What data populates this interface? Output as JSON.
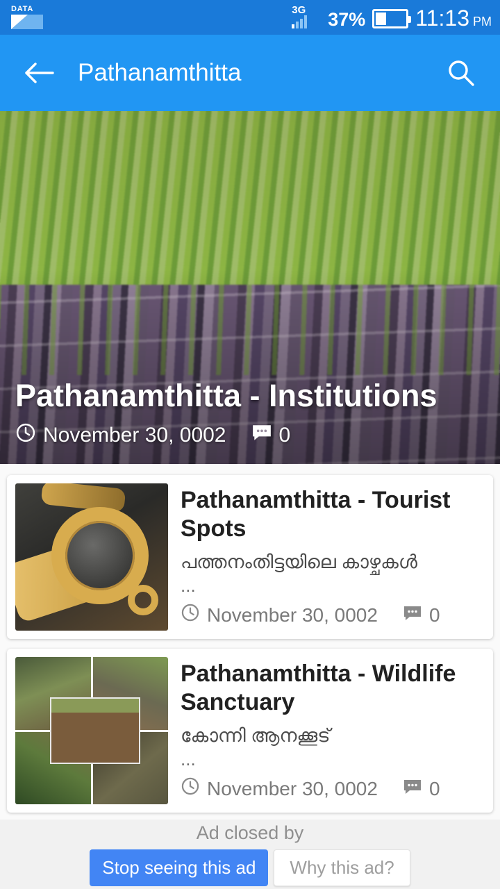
{
  "status_bar": {
    "data_icon_label": "DATA",
    "network_type": "3G",
    "battery_percent": "37%",
    "battery_level": 37,
    "time": "11:13",
    "meridiem": "PM",
    "signal_bars_active": 1,
    "signal_bars_total": 4,
    "background_color": "#1a7ad9"
  },
  "app_bar": {
    "back_icon": "arrow-left-icon",
    "title": "Pathanamthitta",
    "search_icon": "search-icon",
    "background_color": "#2196f3"
  },
  "hero": {
    "image_description": "sugarcane-stalks-photo",
    "title": "Pathanamthitta - Institutions",
    "clock_icon": "clock-icon",
    "date": "November 30, 0002",
    "comment_icon": "comment-icon",
    "comment_count": "0"
  },
  "articles": [
    {
      "thumbnail": "aranmula-metal-mirror-photo",
      "title": "Pathanamthitta - Tourist Spots",
      "subtitle": "പത്തനംതിട്ടയിലെ കാഴ്ചകൾ",
      "ellipsis": "...",
      "clock_icon": "clock-icon",
      "date": "November 30, 0002",
      "comment_icon": "comment-icon",
      "comment_count": "0"
    },
    {
      "thumbnail": "elephant-cage-collage-photo",
      "title": "Pathanamthitta - Wildlife Sanctuary",
      "subtitle": "കോന്നി ആനക്കൂട്",
      "ellipsis": "...",
      "clock_icon": "clock-icon",
      "date": "November 30, 0002",
      "comment_icon": "comment-icon",
      "comment_count": "0"
    }
  ],
  "ad_footer": {
    "label": "Ad closed by",
    "stop_button": "Stop seeing this ad",
    "why_button": "Why this ad?",
    "stop_button_color": "#4285f4",
    "background_color": "#f1f1f1"
  }
}
